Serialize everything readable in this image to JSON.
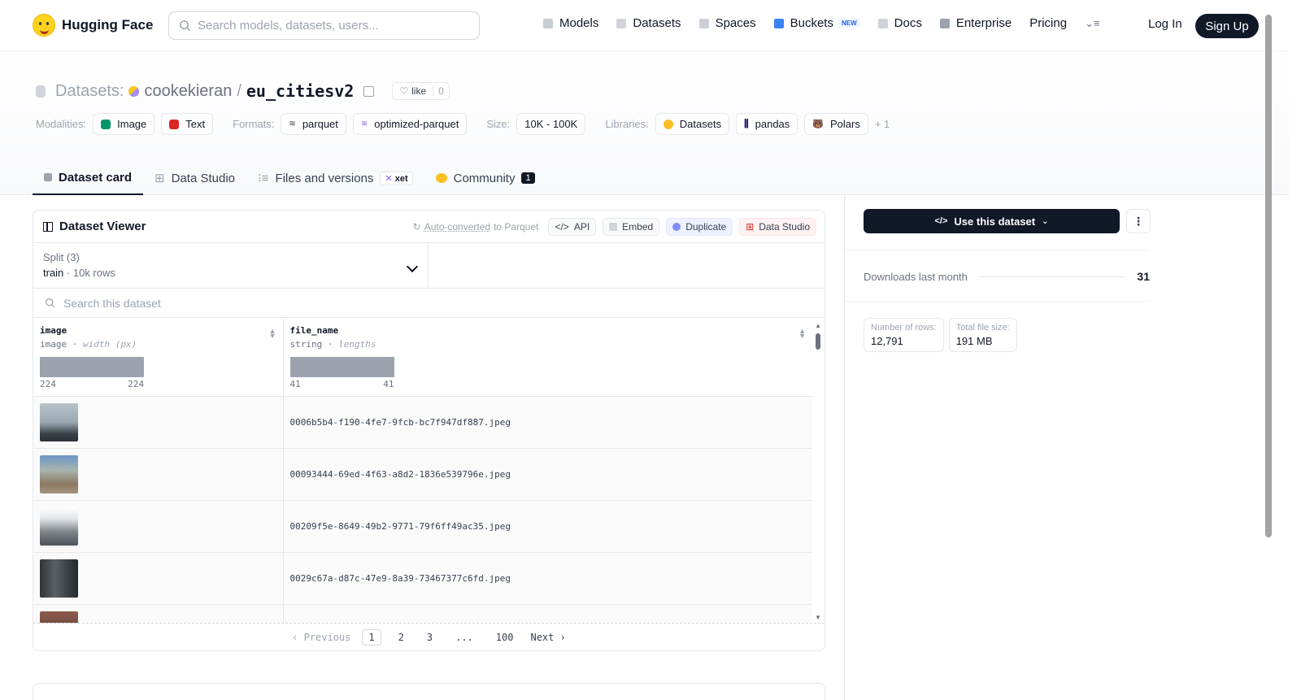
{
  "nav": {
    "brand": "Hugging Face",
    "search_placeholder": "Search models, datasets, users...",
    "links": [
      "Models",
      "Datasets",
      "Spaces",
      "Buckets",
      "Docs",
      "Enterprise",
      "Pricing"
    ],
    "buckets_badge": "NEW",
    "login": "Log In",
    "signup": "Sign Up"
  },
  "repo": {
    "type_label": "Datasets:",
    "owner": "cookekieran",
    "sep": "/",
    "name": "eu_citiesv2",
    "like_label": "like",
    "like_count": "0"
  },
  "meta": {
    "modalities_label": "Modalities:",
    "modalities": [
      "Image",
      "Text"
    ],
    "formats_label": "Formats:",
    "formats": [
      "parquet",
      "optimized-parquet"
    ],
    "size_label": "Size:",
    "size": "10K - 100K",
    "libraries_label": "Libraries:",
    "libraries": [
      "Datasets",
      "pandas",
      "Polars"
    ],
    "libraries_more": "+ 1"
  },
  "tabs": {
    "card": "Dataset card",
    "studio": "Data Studio",
    "files": "Files and versions",
    "xet": "xet",
    "community": "Community",
    "community_count": "1"
  },
  "viewer": {
    "title": "Dataset Viewer",
    "auto_prefix": "Auto-converted",
    "auto_suffix": "to Parquet",
    "api": "API",
    "embed": "Embed",
    "duplicate": "Duplicate",
    "data_studio": "Data Studio",
    "split_label": "Split (3)",
    "split_name": "train",
    "split_rows": "10k rows",
    "search_placeholder": "Search this dataset",
    "columns": [
      {
        "name": "image",
        "type": "image",
        "stat": "width (px)",
        "min": "224",
        "max": "224"
      },
      {
        "name": "file_name",
        "type": "string",
        "stat": "lengths",
        "min": "41",
        "max": "41"
      }
    ],
    "rows": [
      {
        "file_name": "0006b5b4-f190-4fe7-9fcb-bc7f947df887.jpeg"
      },
      {
        "file_name": "00093444-69ed-4f63-a8d2-1836e539796e.jpeg"
      },
      {
        "file_name": "00209f5e-8649-49b2-9771-79f6ff49ac35.jpeg"
      },
      {
        "file_name": "0029c67a-d87c-47e9-8a39-73467377c6fd.jpeg"
      }
    ],
    "pager": {
      "prev": "Previous",
      "pages": [
        "1",
        "2",
        "3",
        "...",
        "100"
      ],
      "next": "Next"
    }
  },
  "side": {
    "use_button": "Use this dataset",
    "downloads_label": "Downloads last month",
    "downloads_value": "31",
    "rows_label": "Number of rows:",
    "rows_value": "12,791",
    "size_label": "Total file size:",
    "size_value": "191 MB"
  }
}
